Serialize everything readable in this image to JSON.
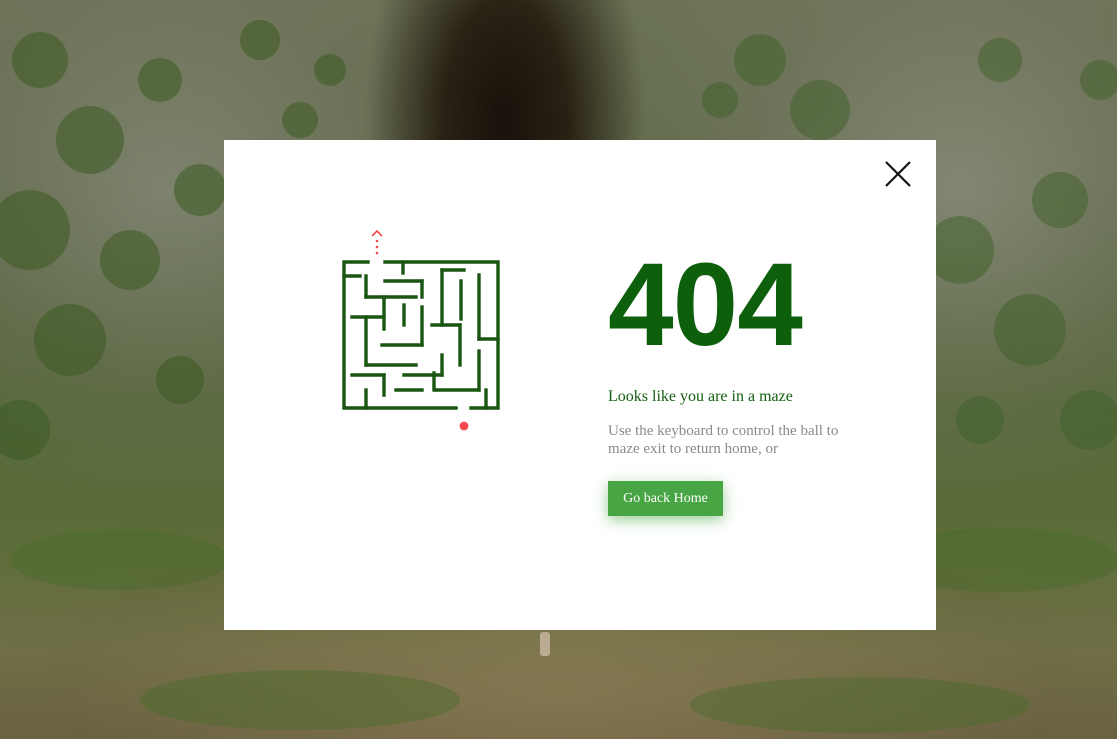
{
  "error": {
    "code": "404",
    "headline": "Looks like you are in a maze",
    "description": "Use the keyboard to control the ball to maze exit to return home, or"
  },
  "actions": {
    "home_button_label": "Go back Home"
  },
  "icons": {
    "close": "close-icon",
    "exit_arrow": "arrow-up-icon"
  },
  "colors": {
    "accent_dark_green": "#0d5f0b",
    "button_green": "#48a544",
    "maze_wall": "#1a5512",
    "ball_red": "#f2484b"
  }
}
